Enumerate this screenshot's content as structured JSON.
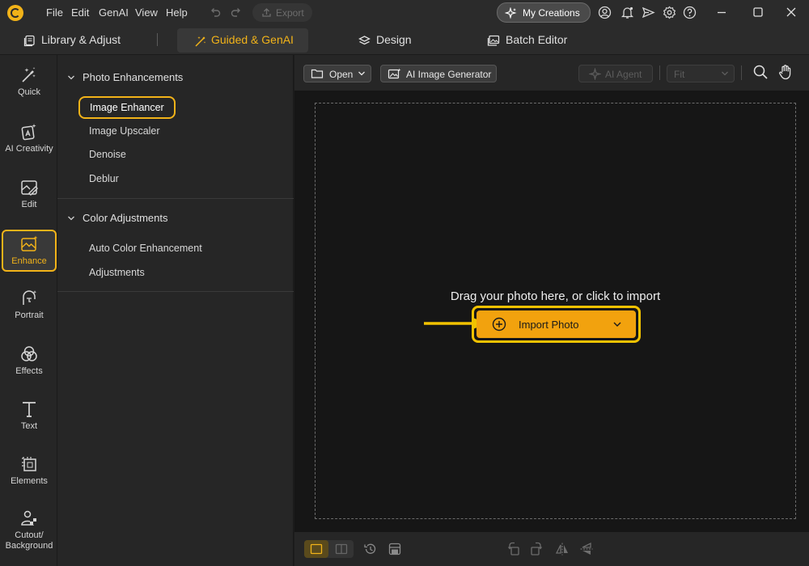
{
  "titlebar": {
    "menu": [
      "File",
      "Edit",
      "GenAI",
      "View",
      "Help"
    ],
    "export_label": "Export",
    "my_creations_label": "My Creations"
  },
  "modes": {
    "library": "Library & Adjust",
    "guided": "Guided & GenAI",
    "design": "Design",
    "batch": "Batch Editor"
  },
  "rail": {
    "quick": "Quick",
    "ai_creativity": "AI Creativity",
    "edit": "Edit",
    "enhance": "Enhance",
    "portrait": "Portrait",
    "effects": "Effects",
    "text": "Text",
    "elements": "Elements",
    "cutout": "Cutout/",
    "background": "Background"
  },
  "panel": {
    "photo_section": "Photo Enhancements",
    "photo_items": [
      "Image Enhancer",
      "Image Upscaler",
      "Denoise",
      "Deblur"
    ],
    "color_section": "Color Adjustments",
    "color_items": [
      "Auto Color Enhancement",
      "Adjustments"
    ]
  },
  "canvas_toolbar": {
    "open_label": "Open",
    "ai_generator_label": "AI Image Generator",
    "ai_agent_label": "AI Agent",
    "zoom_value": "Fit"
  },
  "canvas": {
    "prompt": "Drag your photo here, or click to import",
    "import_label": "Import Photo"
  },
  "colors": {
    "accent": "#f2b319",
    "import_button": "#f2a20e",
    "highlight_ring": "#f2c200"
  }
}
